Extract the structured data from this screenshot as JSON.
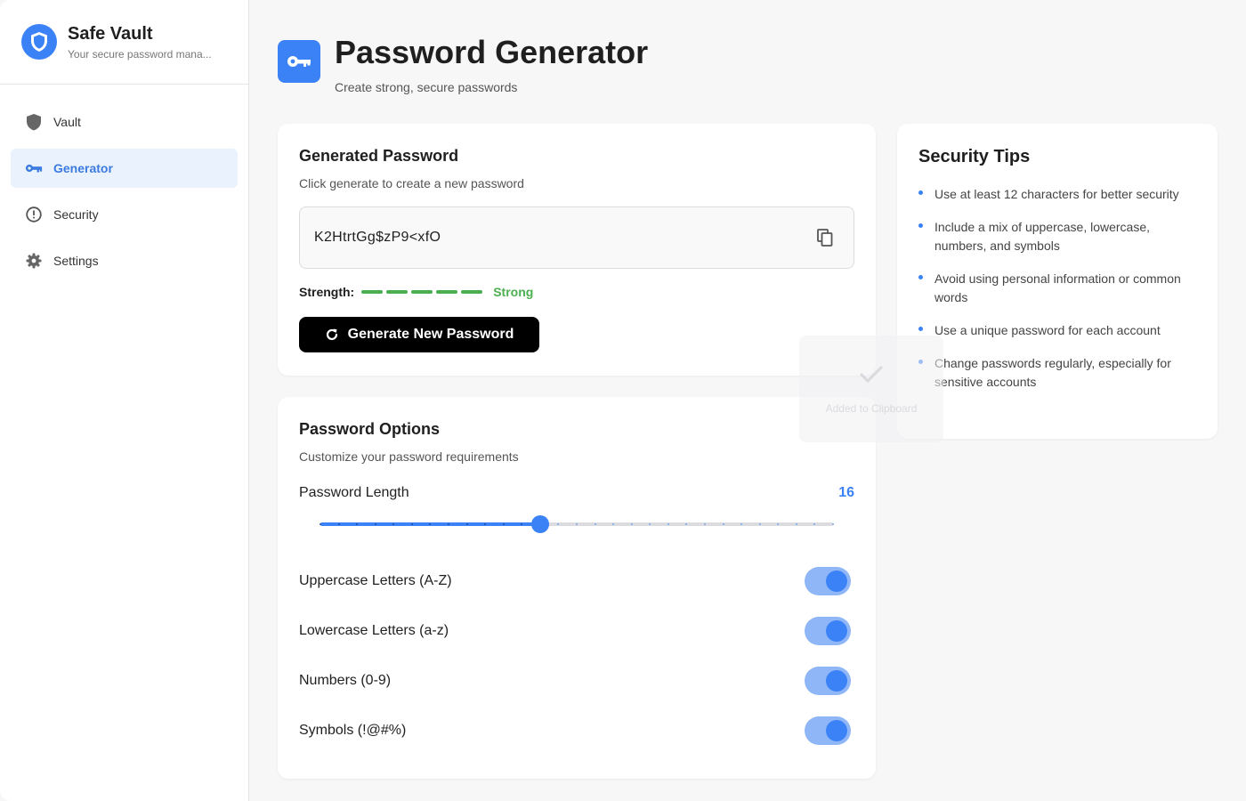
{
  "app": {
    "title": "Safe Vault",
    "subtitle": "Your secure password mana..."
  },
  "sidebar": {
    "items": [
      {
        "label": "Vault",
        "icon": "shield-icon"
      },
      {
        "label": "Generator",
        "icon": "key-icon",
        "active": true
      },
      {
        "label": "Security",
        "icon": "alert-circle-icon"
      },
      {
        "label": "Settings",
        "icon": "gear-icon"
      }
    ]
  },
  "header": {
    "title": "Password Generator",
    "subtitle": "Create strong, secure passwords",
    "icon": "key-icon"
  },
  "generated": {
    "title": "Generated Password",
    "subtitle": "Click generate to create a new password",
    "password": "K2HtrtGg$zP9<xfO",
    "copy_icon": "copy-icon",
    "strength_label": "Strength:",
    "strength_value": "Strong",
    "strength_level": 5,
    "strength_max": 5,
    "generate_label": "Generate New Password"
  },
  "toast": {
    "message": "Added to Clipboard",
    "icon": "check-icon"
  },
  "options": {
    "title": "Password Options",
    "subtitle": "Customize your password requirements",
    "length_label": "Password Length",
    "length_value": "16",
    "length": 16,
    "length_min": 4,
    "length_max": 32,
    "toggles": [
      {
        "label": "Uppercase Letters (A-Z)",
        "on": true
      },
      {
        "label": "Lowercase Letters (a-z)",
        "on": true
      },
      {
        "label": "Numbers (0-9)",
        "on": true
      },
      {
        "label": "Symbols (!@#%)",
        "on": true
      }
    ]
  },
  "tips": {
    "title": "Security Tips",
    "items": [
      "Use at least 12 characters for better security",
      "Include a mix of uppercase, lowercase, numbers, and symbols",
      "Avoid using personal information or common words",
      "Use a unique password for each account",
      "Change passwords regularly, especially for sensitive accounts"
    ]
  },
  "colors": {
    "accent": "#3b82f6",
    "active_bg": "#eaf2fe",
    "strength": "#4caf50",
    "toggle_track": "#8fb6f6"
  }
}
